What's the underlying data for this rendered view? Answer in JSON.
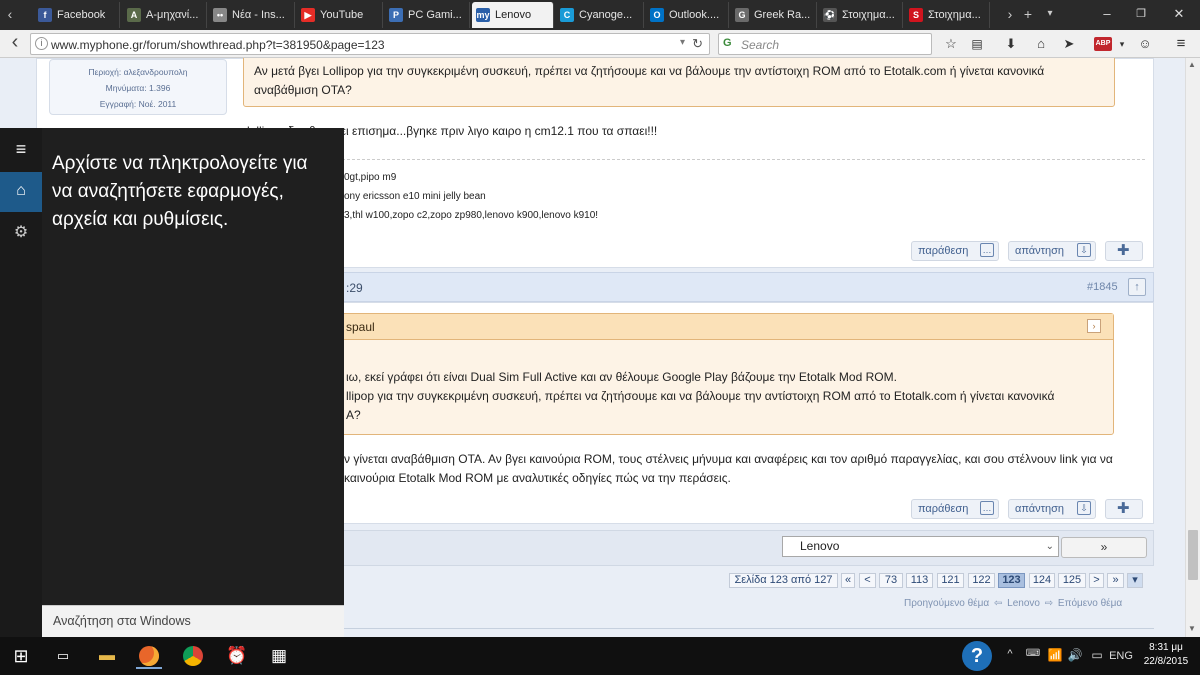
{
  "browser": {
    "tabs": [
      {
        "label": "Facebook",
        "color": "#3b5998",
        "glyph": "f"
      },
      {
        "label": "Α-μηχανί...",
        "color": "#5a6a4a",
        "glyph": "A"
      },
      {
        "label": "Νέα - Ins...",
        "color": "#888888",
        "glyph": "••"
      },
      {
        "label": "YouTube",
        "color": "#e52d27",
        "glyph": "▶"
      },
      {
        "label": "PC Gami...",
        "color": "#3c6eb4",
        "glyph": "P"
      },
      {
        "label": "Lenovo",
        "color": "#2a5fa8",
        "glyph": "my"
      },
      {
        "label": "Cyanoge...",
        "color": "#1a9bd7",
        "glyph": "C"
      },
      {
        "label": "Outlook....",
        "color": "#0072c6",
        "glyph": "O"
      },
      {
        "label": "Greek Ra...",
        "color": "#6a6a6a",
        "glyph": "G"
      },
      {
        "label": "Στοιχημα...",
        "color": "#555555",
        "glyph": "⚽"
      },
      {
        "label": "Στοιχημα...",
        "color": "#d0141e",
        "glyph": "S"
      }
    ],
    "url": "www.myphone.gr/forum/showthread.php?t=381950&page=123",
    "search_placeholder": "Search",
    "abp_label": "ABP"
  },
  "profile": {
    "region": "Περιοχή: αλεξανδρουπολη",
    "posts": "Μηνύματα: 1.396",
    "joined": "Εγγραφή: Νοέ. 2011"
  },
  "post1": {
    "quote_text_1": "Αν μετά βγει Lollipop για την συγκεκριμένη συσκευή, πρέπει να ζητήσουμε και να βάλουμε την αντίστοιχη ROM από το Etotalk.com ή γίνεται κανονικά",
    "quote_text_2": "αναβάθμιση OTA?",
    "reply_text": "lollipop δεν θα γινει επισημα...βγηκε πριν λιγο καιρο η cm12.1 που τα σπαει!!!",
    "sig_1": "0gt,pipo m9",
    "sig_2": "ony ericsson e10 mini jelly bean",
    "sig_3": "3,thl w100,zopo c2,zopo zp980,lenovo k900,lenovo k910!",
    "btn_quote": "παράθεση",
    "btn_reply": "απάντηση"
  },
  "post2": {
    "time": ":29",
    "number": "#1845",
    "quote_author": "spaul",
    "quote_line_1": "ιω, εκεί γράφει ότι είναι Dual Sim Full Active και αν θέλουμε Google Play βάζουμε την Etotalk Mod ROM.",
    "quote_line_2": "llipop για την συγκεκριμένη συσκευή, πρέπει να ζητήσουμε και να βάλουμε την αντίστοιχη ROM από το Etotalk.com ή γίνεται κανονικά",
    "quote_line_3": "A?",
    "reply_line_1": "ν γίνεται αναβάθμιση ΟΤΑ. Αν βγει καινούρια ROM, τους στέλνεις μήνυμα και αναφέρεις και τον αριθμό παραγγελίας, και σου στέλνουν link για να",
    "reply_line_2": "καινούρια Etotalk Mod ROM με αναλυτικές οδηγίες πώς να την περάσεις.",
    "btn_quote": "παράθεση",
    "btn_reply": "απάντηση"
  },
  "forum_jump": {
    "selected": "Lenovo",
    "go_label": "»"
  },
  "pagination": {
    "summary": "Σελίδα 123 από 127",
    "first": "«",
    "prev": "<",
    "pages": [
      "73",
      "113",
      "121",
      "122",
      "123",
      "124",
      "125"
    ],
    "current": "123",
    "next": ">",
    "last": "»"
  },
  "thread_nav": {
    "previous": "Προηγούμενο θέμα",
    "forum": "Lenovo",
    "next": "Επόμενο θέμα"
  },
  "start_search": {
    "message": "Αρχίστε να πληκτρολογείτε για να αναζητήσετε εφαρμογές, αρχεία και ρυθμίσεις.",
    "box_placeholder": "Αναζήτηση στα Windows"
  },
  "taskbar": {
    "language": "ENG",
    "time": "8:31 μμ",
    "date": "22/8/2015",
    "help_glyph": "?"
  },
  "colors": {
    "page_bg": "#e9eef6",
    "link_blue": "#41608f",
    "quote_bg": "#fdf3e6",
    "quote_border": "#e2b57a",
    "taskbar_bg": "#101010"
  }
}
